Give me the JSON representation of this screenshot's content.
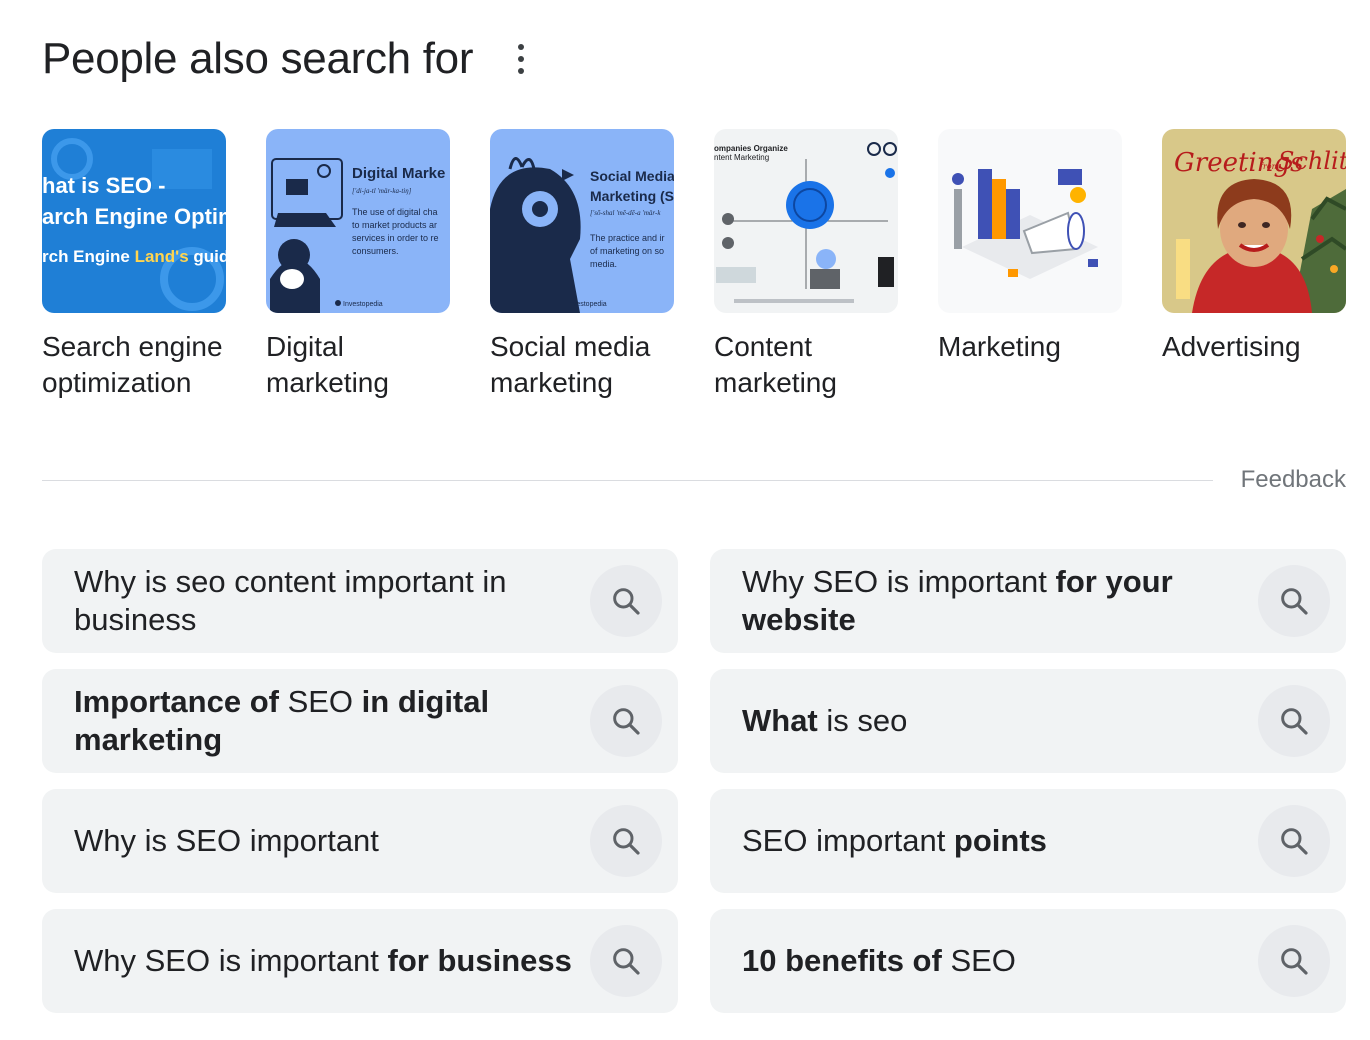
{
  "header": {
    "title": "People also search for"
  },
  "cards": [
    {
      "label": "Search engine optimization",
      "thumb": {
        "line1": "hat is SEO -",
        "line2": "arch Engine Optimiz",
        "line3a": "rch Engine ",
        "line3b": "Land's",
        "line3c": " guide to"
      }
    },
    {
      "label": "Digital marketing",
      "thumb": {
        "title": "Digital Marke",
        "phon": "['di-ja-tl 'mär-ka-tiŋ]",
        "desc1": "The use of digital cha",
        "desc2": "to market products ar",
        "desc3": "services in order to re",
        "desc4": "consumers.",
        "brand": "Investopedia"
      }
    },
    {
      "label": "Social media marketing",
      "thumb": {
        "title1": "Social Media",
        "title2": "Marketing (S",
        "phon": "['sō-shal 'mē-dē-a 'mär-k",
        "desc1": "The practice and ir",
        "desc2": "of marketing on so",
        "desc3": "media.",
        "brand": "Investopedia"
      }
    },
    {
      "label": "Content marketing",
      "thumb": {
        "head1": "ompanies Organize",
        "head2": "ntent Marketing"
      }
    },
    {
      "label": "Marketing"
    },
    {
      "label": "Advertising",
      "thumb": {
        "script1": "Greetings",
        "script2": "from",
        "script3": "Schlitz"
      }
    }
  ],
  "feedback_label": "Feedback",
  "queries": [
    {
      "parts": [
        {
          "t": "Why is seo content important in business",
          "b": false
        }
      ]
    },
    {
      "parts": [
        {
          "t": "Why SEO is important ",
          "b": false
        },
        {
          "t": "for your website",
          "b": true
        }
      ]
    },
    {
      "parts": [
        {
          "t": "Importance of",
          "b": true
        },
        {
          "t": " SEO ",
          "b": false
        },
        {
          "t": "in digital marketing",
          "b": true
        }
      ]
    },
    {
      "parts": [
        {
          "t": "What",
          "b": true
        },
        {
          "t": " is seo",
          "b": false
        }
      ]
    },
    {
      "parts": [
        {
          "t": "Why is SEO important",
          "b": false
        }
      ]
    },
    {
      "parts": [
        {
          "t": "SEO important ",
          "b": false
        },
        {
          "t": "points",
          "b": true
        }
      ]
    },
    {
      "parts": [
        {
          "t": "Why SEO is important ",
          "b": false
        },
        {
          "t": "for business",
          "b": true
        }
      ]
    },
    {
      "parts": [
        {
          "t": "10 benefits of",
          "b": true
        },
        {
          "t": " SEO",
          "b": false
        }
      ]
    }
  ],
  "icons": {
    "more": "more-vert-icon",
    "search": "search-icon"
  },
  "colors": {
    "chip_bg": "#f1f3f4",
    "icon_circle": "#e8eaed",
    "thumb_blue": "#1a73e8",
    "thumb_light_blue": "#8ab4f8"
  }
}
